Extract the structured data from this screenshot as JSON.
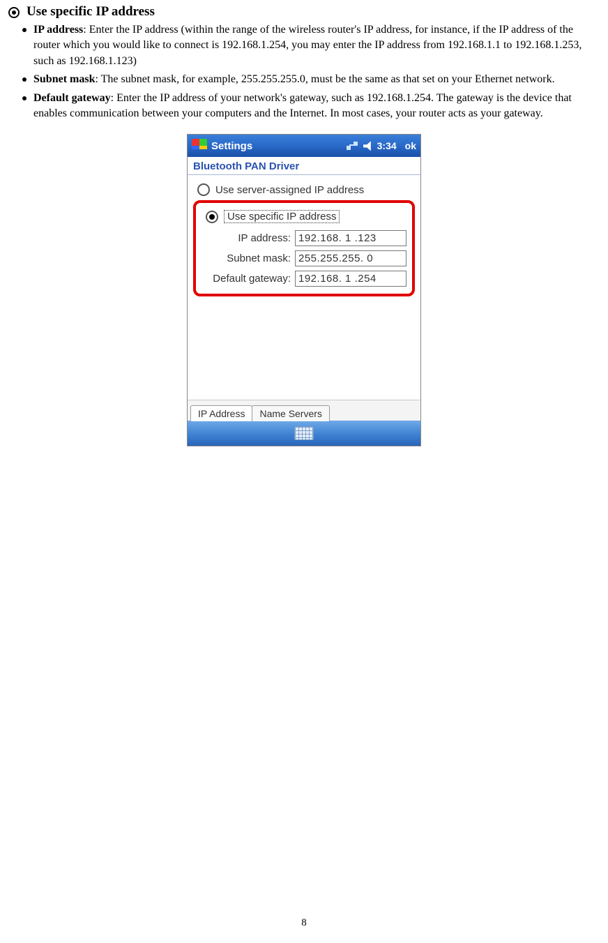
{
  "doc": {
    "heading": "Use specific IP address",
    "bullets": [
      {
        "term": "IP address",
        "text": ": Enter the IP address (within the range of the wireless router's IP address, for instance, if the IP address of the router which you would like to connect is 192.168.1.254, you may enter the IP address  from 192.168.1.1 to 192.168.1.253, such as 192.168.1.123)"
      },
      {
        "term": "Subnet mask",
        "text": ": The subnet mask, for example, 255.255.255.0, must be the same as that set on your Ethernet network."
      },
      {
        "term": "Default gateway",
        "text": ": Enter the IP address of your network's gateway, such as 192.168.1.254. The gateway is the device that enables communication between your computers and the Internet. In most cases, your router acts as your gateway."
      }
    ],
    "page_number": "8"
  },
  "screenshot": {
    "titlebar": {
      "title": "Settings",
      "time": "3:34",
      "ok": "ok"
    },
    "subheader": "Bluetooth PAN Driver",
    "radio1_label": "Use server-assigned IP address",
    "radio2_label": "Use specific IP address",
    "fields": {
      "ip_label": "IP address:",
      "ip_value": "192.168. 1 .123",
      "subnet_label": "Subnet mask:",
      "subnet_value": "255.255.255. 0",
      "gateway_label": "Default gateway:",
      "gateway_value": "192.168. 1 .254"
    },
    "tabs": {
      "tab1": "IP Address",
      "tab2": "Name Servers"
    }
  }
}
